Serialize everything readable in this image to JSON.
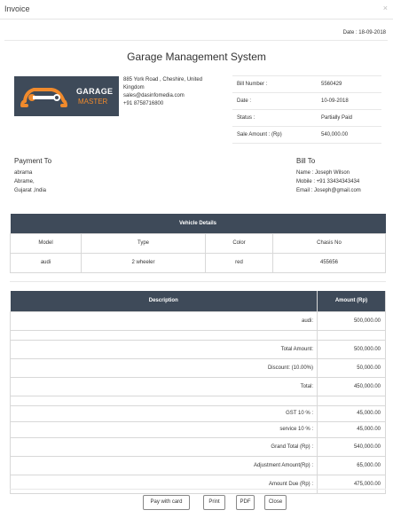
{
  "modal": {
    "title": "Invoice",
    "close_glyph": "×"
  },
  "date_line": "Date : 18-09-2018",
  "system_title": "Garage Management System",
  "logo": {
    "line1": "GARAGE",
    "line2": "MASTER"
  },
  "address": [
    "885 York Road , Cheshire, United",
    "Kingdom",
    "sales@dasinfomedia.com",
    "+91 8758716800"
  ],
  "bill_info": [
    {
      "label": "Bill Number :",
      "value": "5560429"
    },
    {
      "label": "Date :",
      "value": "10-09-2018"
    },
    {
      "label": "Status :",
      "value": "Partially Paid"
    },
    {
      "label": "Sale Amount : (Rp)",
      "value": "540,000.00"
    }
  ],
  "payment_to": {
    "heading": "Payment To",
    "lines": [
      "abrama",
      "Abrame,",
      "Gujarat ,India"
    ]
  },
  "bill_to": {
    "heading": "Bill To",
    "lines": [
      "Name : Joseph Wilson",
      "Mobile : +91 33434343434",
      "Email : Joseph@gmail.com"
    ]
  },
  "vehicle": {
    "title": "Vehicle Details",
    "headers": [
      "Model",
      "Type",
      "Color",
      "Chasis No"
    ],
    "row": [
      "audi",
      "2 wheeler",
      "red",
      "455656"
    ]
  },
  "desc_table": {
    "headers": [
      "Description",
      "Amount (Rp)"
    ],
    "item": {
      "desc": "audi:",
      "amount": "500,000.00"
    },
    "totals": [
      {
        "label": "Total Amount:",
        "value": "500,000.00"
      },
      {
        "label": "Discount: (10.00%)",
        "value": "50,000.00"
      },
      {
        "label": "Total:",
        "value": "450,000.00"
      }
    ],
    "taxes": [
      {
        "label": "GST 10 % :",
        "value": "45,000.00"
      },
      {
        "label": "service 10 % :",
        "value": "45,000.00"
      },
      {
        "label": "Grand Total (Rp) :",
        "value": "540,000.00"
      },
      {
        "label": "Adjustment Amount(Rp) :",
        "value": "65,000.00"
      },
      {
        "label": "Amount Due (Rp) :",
        "value": "475,000.00"
      }
    ]
  },
  "buttons": {
    "pay": "Pay with card",
    "print": "Print",
    "pdf": "PDF",
    "close": "Close"
  },
  "colors": {
    "header_bg": "#3e4a59",
    "logo_accent": "#f08a2c"
  }
}
